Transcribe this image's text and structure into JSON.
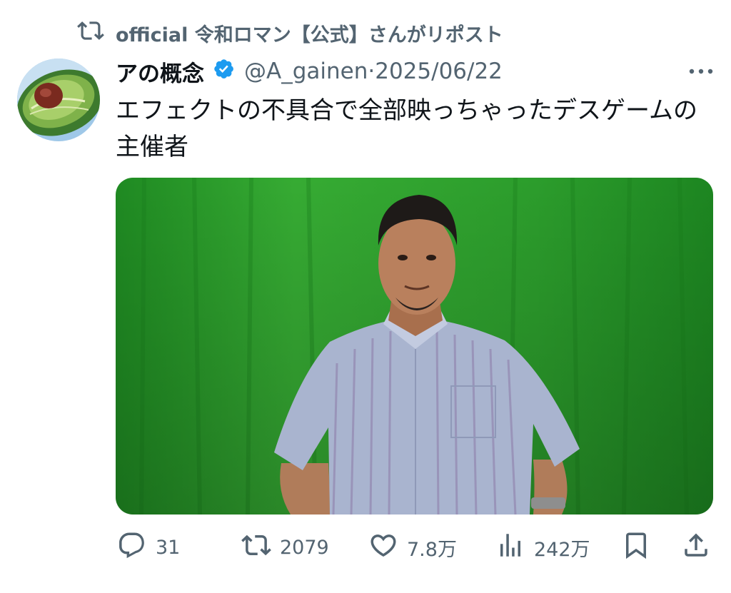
{
  "repost": {
    "icon": "repost-icon",
    "text": "official 令和ロマン【公式】さんがリポスト"
  },
  "author": {
    "avatar_icon": "avocado-avatar",
    "display_name": "アの概念",
    "verified_icon": "verified-badge-icon",
    "handle": "@A_gainen",
    "separator": "·",
    "date": "2025/06/22"
  },
  "more_icon": "more-dots-icon",
  "tweet": {
    "text": "エフェクトの不具合で全部映っちゃったデスゲームの主催者"
  },
  "media": {
    "description_icon": "photo-man-green-screen"
  },
  "actions": {
    "reply": {
      "icon": "reply-icon",
      "count": "31"
    },
    "repost": {
      "icon": "repost-icon",
      "count": "2079"
    },
    "like": {
      "icon": "heart-icon",
      "count": "7.8万"
    },
    "views": {
      "icon": "views-bar-chart-icon",
      "count": "242万"
    },
    "bookmark": {
      "icon": "bookmark-icon"
    },
    "share": {
      "icon": "share-icon"
    }
  },
  "colors": {
    "text_primary": "#0f1419",
    "text_secondary": "#536471",
    "verified_blue": "#1d9bf0",
    "green_screen": "#2f9f2a"
  }
}
